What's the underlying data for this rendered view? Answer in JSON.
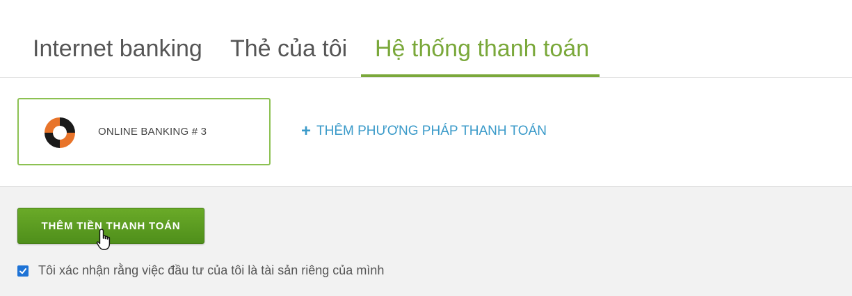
{
  "tabs": [
    {
      "label": "Internet banking",
      "active": false
    },
    {
      "label": "Thẻ của tôi",
      "active": false
    },
    {
      "label": "Hệ thống thanh toán",
      "active": true
    }
  ],
  "payment_method": {
    "label": "ONLINE BANKING # 3",
    "logo_icon": "swirl-logo-icon",
    "selected": true
  },
  "add_method": {
    "icon": "plus-icon",
    "label": "THÊM PHƯƠNG PHÁP THANH TOÁN"
  },
  "pay_button": {
    "label": "THÊM TIỀN THANH TOÁN"
  },
  "confirm": {
    "checked": true,
    "label": "Tôi xác nhận rằng việc đầu tư của tôi là tài sản riêng của mình"
  },
  "colors": {
    "accent_green": "#7aa83a",
    "button_green": "#5a9a20",
    "link_blue": "#3a9ac9",
    "checkbox_blue": "#1e73d6",
    "logo_orange": "#e8742a"
  }
}
